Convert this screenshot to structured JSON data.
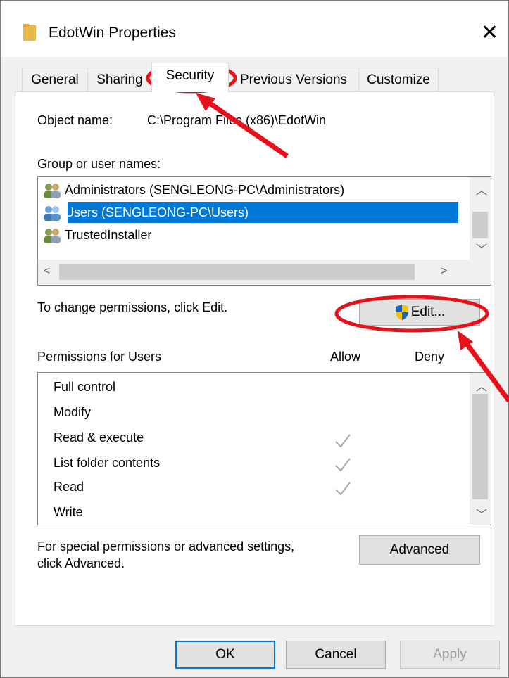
{
  "window": {
    "title": "EdotWin Properties",
    "close_glyph": "✕"
  },
  "tabs": [
    {
      "label": "General"
    },
    {
      "label": "Sharing"
    },
    {
      "label": "Security"
    },
    {
      "label": "Previous Versions"
    },
    {
      "label": "Customize"
    }
  ],
  "object": {
    "label": "Object name:",
    "value": "C:\\Program Files (x86)\\EdotWin"
  },
  "groups": {
    "label": "Group or user names:",
    "items": [
      {
        "name": "Administrators (SENGLEONG-PC\\Administrators)",
        "selected": false
      },
      {
        "name": "Users (SENGLEONG-PC\\Users)",
        "selected": true
      },
      {
        "name": "TrustedInstaller",
        "selected": false
      }
    ]
  },
  "change_hint": "To change permissions, click Edit.",
  "edit_button": "Edit...",
  "permissions": {
    "header": "Permissions for Users",
    "allow_col": "Allow",
    "deny_col": "Deny",
    "rows": [
      {
        "name": "Full control",
        "allow": false
      },
      {
        "name": "Modify",
        "allow": false
      },
      {
        "name": "Read & execute",
        "allow": true
      },
      {
        "name": "List folder contents",
        "allow": true
      },
      {
        "name": "Read",
        "allow": true
      },
      {
        "name": "Write",
        "allow": false
      }
    ]
  },
  "advanced": {
    "hint_line1": "For special permissions or advanced settings,",
    "hint_line2": "click Advanced.",
    "button": "Advanced"
  },
  "footer": {
    "ok": "OK",
    "cancel": "Cancel",
    "apply": "Apply"
  },
  "colors": {
    "selection": "#0078d7",
    "annotation": "#e8101a",
    "uac_shield_blue": "#1f5fbf",
    "uac_shield_yellow": "#f5c400"
  }
}
